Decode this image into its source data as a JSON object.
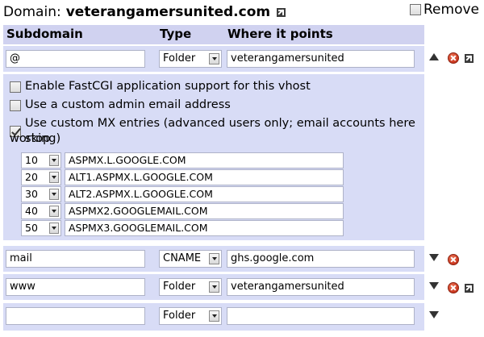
{
  "domain": {
    "label": "Domain:",
    "name": "veterangamersunited.com",
    "remove_label": "Remove"
  },
  "columns": {
    "subdomain": "Subdomain",
    "type": "Type",
    "target": "Where it points"
  },
  "records": [
    {
      "subdomain": "@",
      "type": "Folder",
      "target": "veterangamersunited"
    },
    {
      "subdomain": "mail",
      "type": "CNAME",
      "target": "ghs.google.com"
    },
    {
      "subdomain": "www",
      "type": "Folder",
      "target": "veterangamersunited"
    },
    {
      "subdomain": "",
      "type": "Folder",
      "target": ""
    }
  ],
  "options": {
    "fastcgi": {
      "label": "Enable FastCGI application support for this vhost",
      "checked": false
    },
    "admin_email": {
      "label": "Use a custom admin email address",
      "checked": false
    },
    "mx": {
      "label_line1": "Use custom MX entries (advanced users only; email accounts here stop",
      "label_line2": "working)",
      "checked": true
    }
  },
  "mx_entries": [
    {
      "priority": "10",
      "host": "ASPMX.L.GOOGLE.COM"
    },
    {
      "priority": "20",
      "host": "ALT1.ASPMX.L.GOOGLE.COM"
    },
    {
      "priority": "30",
      "host": "ALT2.ASPMX.L.GOOGLE.COM"
    },
    {
      "priority": "40",
      "host": "ASPMX2.GOOGLEMAIL.COM"
    },
    {
      "priority": "50",
      "host": "ASPMX3.GOOGLEMAIL.COM"
    }
  ],
  "icons": {
    "external": "external-link-icon",
    "delete": "delete-icon",
    "move_up": "move-up-icon",
    "move_down": "move-down-icon"
  }
}
